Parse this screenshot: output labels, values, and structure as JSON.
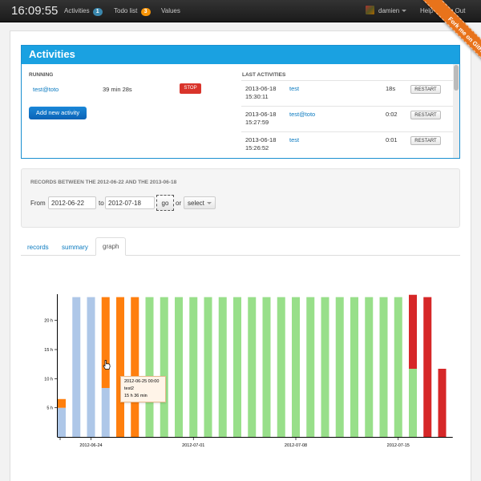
{
  "navbar": {
    "clock": "16:09:55",
    "activities_label": "Activities",
    "activities_count": "1",
    "todo_label": "Todo list",
    "todo_count": "3",
    "values_label": "Values",
    "user": "damien",
    "help": "Help",
    "logout": "Log Out"
  },
  "ribbon": "Fork me on GitHub",
  "activities": {
    "title": "Activities",
    "running_title": "RUNNING",
    "running": {
      "name": "test@toto",
      "duration": "39 min 28s",
      "stop_label": "STOP"
    },
    "add_label": "Add new activity",
    "last_title": "LAST ACTIVITIES",
    "last": [
      {
        "date": "2013-06-18",
        "time": "15:30:11",
        "name": "test",
        "duration": "18s",
        "action": "RESTART"
      },
      {
        "date": "2013-06-18",
        "time": "15:27:59",
        "name": "test@toto",
        "duration": "0:02",
        "action": "RESTART"
      },
      {
        "date": "2013-06-18",
        "time": "15:26:52",
        "name": "test",
        "duration": "0:01",
        "action": "RESTART"
      }
    ]
  },
  "records": {
    "title": "RECORDS BETWEEN THE 2012-06-22 AND THE 2013-06-18",
    "from_label": "From",
    "from_value": "2012-06-22",
    "to_label": "to",
    "to_value": "2012-07-18",
    "go_label": "go",
    "or_label": "or",
    "select_label": "select"
  },
  "tabs": {
    "records": "records",
    "summary": "summary",
    "graph": "graph"
  },
  "tooltip": {
    "line1": "2012-06-25 00:00",
    "line2": "test2",
    "line3": "15 h 36 min"
  },
  "colors": {
    "blue": "#aec7e8",
    "orange": "#ff7f0e",
    "green": "#98df8a",
    "red": "#d62728"
  },
  "chart_data": {
    "type": "bar",
    "stacked": true,
    "y_ticks": [
      "5 h",
      "10 h",
      "15 h",
      "20 h"
    ],
    "y_tick_values": [
      5,
      10,
      15,
      20
    ],
    "ylim": [
      0,
      24.5
    ],
    "x_tick_labels": [
      "2012-06-24",
      "2012-07-01",
      "2012-07-08",
      "2012-07-15"
    ],
    "x_tick_days": [
      2,
      9,
      16,
      23
    ],
    "bars": [
      {
        "day": 0,
        "segments": [
          {
            "color": "blue",
            "value": 5
          },
          {
            "color": "orange",
            "value": 1.5
          }
        ]
      },
      {
        "day": 1,
        "segments": [
          {
            "color": "blue",
            "value": 24
          }
        ]
      },
      {
        "day": 2,
        "segments": [
          {
            "color": "blue",
            "value": 24
          }
        ]
      },
      {
        "day": 3,
        "segments": [
          {
            "color": "blue",
            "value": 8.4
          },
          {
            "color": "orange",
            "value": 15.6
          }
        ]
      },
      {
        "day": 4,
        "segments": [
          {
            "color": "orange",
            "value": 24
          }
        ]
      },
      {
        "day": 5,
        "segments": [
          {
            "color": "orange",
            "value": 24
          }
        ]
      },
      {
        "day": 6,
        "segments": [
          {
            "color": "green",
            "value": 24
          }
        ]
      },
      {
        "day": 7,
        "segments": [
          {
            "color": "green",
            "value": 24
          }
        ]
      },
      {
        "day": 8,
        "segments": [
          {
            "color": "green",
            "value": 24
          }
        ]
      },
      {
        "day": 9,
        "segments": [
          {
            "color": "green",
            "value": 24
          }
        ]
      },
      {
        "day": 10,
        "segments": [
          {
            "color": "green",
            "value": 24
          }
        ]
      },
      {
        "day": 11,
        "segments": [
          {
            "color": "green",
            "value": 24
          }
        ]
      },
      {
        "day": 12,
        "segments": [
          {
            "color": "green",
            "value": 24
          }
        ]
      },
      {
        "day": 13,
        "segments": [
          {
            "color": "green",
            "value": 24
          }
        ]
      },
      {
        "day": 14,
        "segments": [
          {
            "color": "green",
            "value": 24
          }
        ]
      },
      {
        "day": 15,
        "segments": [
          {
            "color": "green",
            "value": 24
          }
        ]
      },
      {
        "day": 16,
        "segments": [
          {
            "color": "green",
            "value": 24
          }
        ]
      },
      {
        "day": 17,
        "segments": [
          {
            "color": "green",
            "value": 24
          }
        ]
      },
      {
        "day": 18,
        "segments": [
          {
            "color": "green",
            "value": 24
          }
        ]
      },
      {
        "day": 19,
        "segments": [
          {
            "color": "green",
            "value": 24
          }
        ]
      },
      {
        "day": 20,
        "segments": [
          {
            "color": "green",
            "value": 24
          }
        ]
      },
      {
        "day": 21,
        "segments": [
          {
            "color": "green",
            "value": 24
          }
        ]
      },
      {
        "day": 22,
        "segments": [
          {
            "color": "green",
            "value": 24
          }
        ]
      },
      {
        "day": 23,
        "segments": [
          {
            "color": "green",
            "value": 24
          }
        ]
      },
      {
        "day": 24,
        "segments": [
          {
            "color": "green",
            "value": 11.7
          },
          {
            "color": "red",
            "value": 12.7
          }
        ]
      },
      {
        "day": 25,
        "segments": [
          {
            "color": "red",
            "value": 24
          }
        ]
      },
      {
        "day": 26,
        "segments": [
          {
            "color": "red",
            "value": 11.7
          }
        ]
      }
    ]
  }
}
